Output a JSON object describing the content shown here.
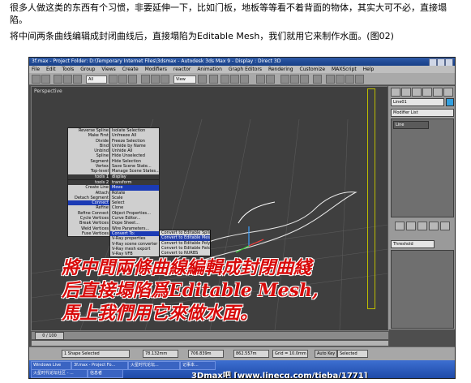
{
  "intro": {
    "line1": "很多人做这类的东西有个习惯，非要延伸一下，比如门板，地板等等看不着背面的物体，其实大可不必，直接塌陷。",
    "line2": "将中间两条曲线编辑成封闭曲线后，直接塌陷为Editable Mesh，我们就用它来制作水面。(图02)"
  },
  "app": {
    "title": "3f.max - Project Folder: D:\\Temporary Internet Files\\3dsmax - Autodesk 3ds Max 9 - Display : Direct 3D",
    "menus": [
      "File",
      "Edit",
      "Tools",
      "Group",
      "Views",
      "Create",
      "Modifiers",
      "reactor",
      "Animation",
      "Graph Editors",
      "Rendering",
      "Customize",
      "MAXScript",
      "Help"
    ],
    "selection_filter": "All",
    "view_dropdown": "View",
    "viewport_label": "Perspective"
  },
  "quad_menu": {
    "top_left": [
      "Reverse Spline",
      "Make First",
      "Divide",
      "Bind",
      "Unbind",
      "Spline",
      "Segment",
      "Vertex",
      "Top-level"
    ],
    "top_left_header": "tools 1",
    "bottom_left_header": "tools 2",
    "bottom_left": [
      "Create Line",
      "Attach",
      "Detach Segment",
      "Connect",
      "Refine",
      "Refine Connect",
      "Cycle Vertices",
      "Break Vertices",
      "Weld Vertices",
      "Fuse Vertices"
    ],
    "top_right_header": "display",
    "top_right": [
      "Isolate Selection",
      "Unfreeze All",
      "Freeze Selection",
      "Unhide by Name",
      "Unhide All",
      "Hide Unselected",
      "Hide Selection",
      "Save Scene State...",
      "Manage Scene States..."
    ],
    "bottom_right_header": "transform",
    "bottom_right": [
      "Move",
      "Rotate",
      "Scale",
      "Select",
      "Clone",
      "Object Properties...",
      "Curve Editor...",
      "Dope Sheet...",
      "Wire Parameters...",
      "Convert To:",
      "V-Ray properties",
      "V-Ray scene converter",
      "V-Ray mesh export",
      "V-Ray VFB"
    ],
    "convert_submenu": [
      "Convert to Editable Spline",
      "Convert to Editable Mesh",
      "Convert to Editable Poly",
      "Convert to Editable Patch",
      "Convert to NURBS"
    ]
  },
  "command_panel": {
    "object_name": "Line01",
    "modifier_list": "Modifier List",
    "stack_item": "Line",
    "threshold_label": "Threshold"
  },
  "overlay": {
    "line1": "將中間兩條曲線編輯成封閉曲綫",
    "line2": "后直接塌陷爲Editable Mesh,",
    "line3": "馬上我們用它來做水面。"
  },
  "timeline": {
    "frame": "0 / 100"
  },
  "status": {
    "selected": "1 Shape Selected",
    "x": "78.132mm",
    "y": "706.839m",
    "z": "862.557m",
    "grid": "Grid = 10.0mm",
    "auto_key": "Auto Key",
    "selected_dropdown": "Selected"
  },
  "taskbar": {
    "items": [
      "Windows Live",
      "3f.max - Project Fo...",
      "火星时代论坛...",
      "记事本..."
    ],
    "row2": [
      "火星时代论坛社区 - ...",
      "信息者"
    ],
    "watermark": "3Dmax吧 [www.linecg.com/tieba/1771]"
  },
  "colors": {
    "overlay_text": "#d80a0a",
    "menu_highlight": "#1b3bb5",
    "taskbar": "#2456b8"
  }
}
